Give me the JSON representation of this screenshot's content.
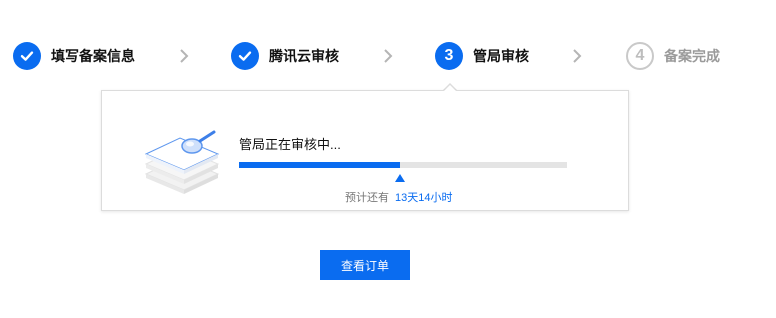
{
  "steps": [
    {
      "label": "填写备案信息",
      "state": "done",
      "icon": "check-icon"
    },
    {
      "label": "腾讯云审核",
      "state": "done",
      "icon": "check-icon"
    },
    {
      "label": "管局审核",
      "state": "active",
      "number": "3"
    },
    {
      "label": "备案完成",
      "state": "pending",
      "number": "4"
    }
  ],
  "review": {
    "status_text": "管局正在审核中...",
    "progress": 0.49,
    "eta_label": "预计还有",
    "eta_value": "13天14小时"
  },
  "actions": {
    "view_order_label": "查看订单"
  },
  "colors": {
    "accent": "#0a6cf0",
    "track": "#e4e4e4",
    "pending": "#9a9a9a"
  }
}
